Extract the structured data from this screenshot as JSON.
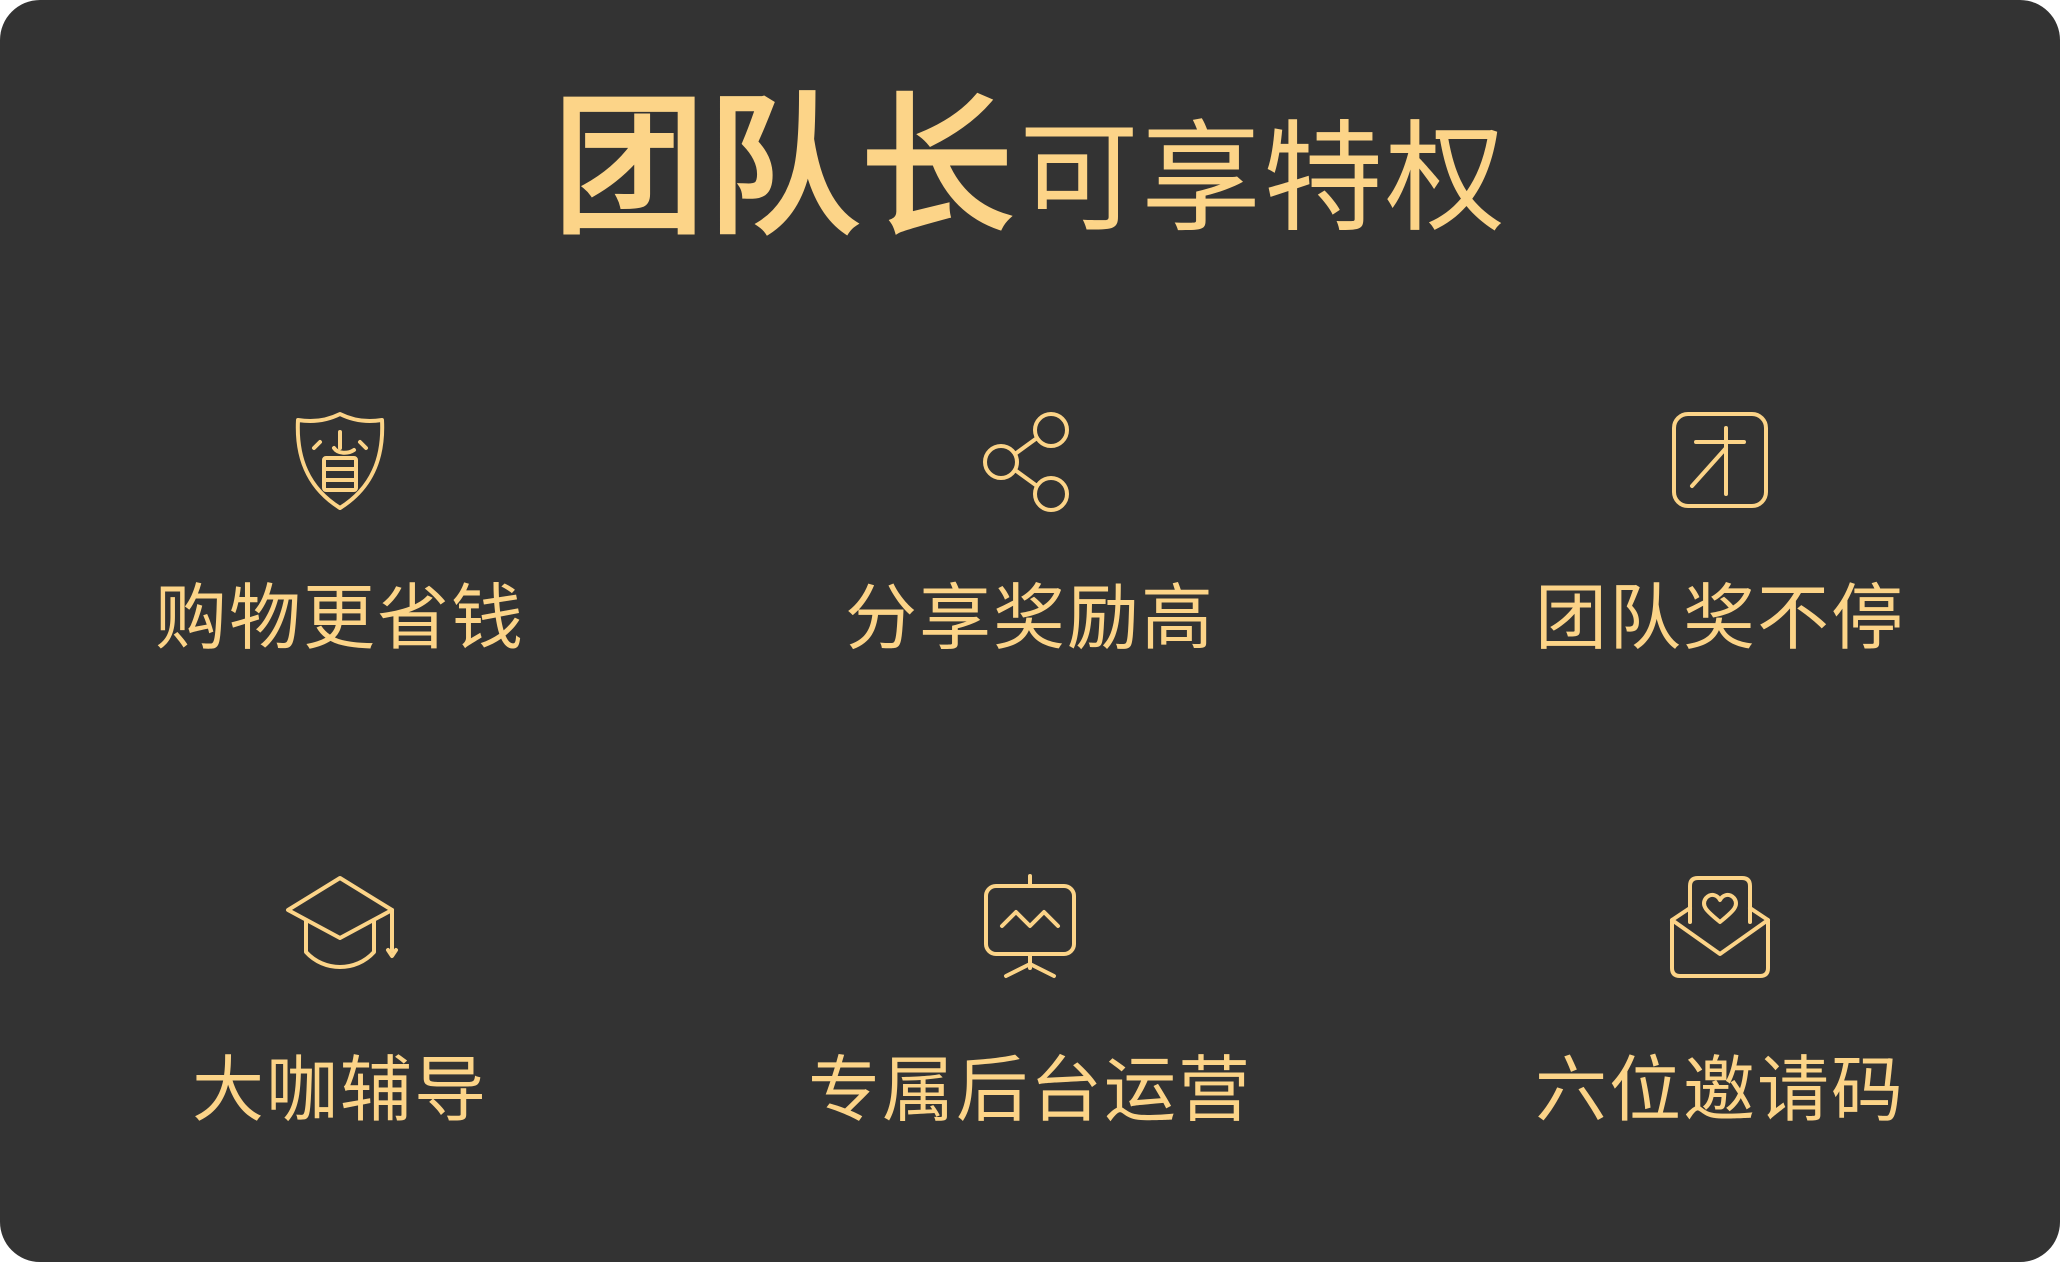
{
  "title": {
    "bold": "团队长",
    "light": "可享特权"
  },
  "privileges": [
    {
      "label": "购物更省钱",
      "icon": "shield-save-icon"
    },
    {
      "label": "分享奖励高",
      "icon": "share-icon"
    },
    {
      "label": "团队奖不停",
      "icon": "talent-box-icon"
    },
    {
      "label": "大咖辅导",
      "icon": "graduation-cap-icon"
    },
    {
      "label": "专属后台运营",
      "icon": "dashboard-screen-icon"
    },
    {
      "label": "六位邀请码",
      "icon": "invite-envelope-icon"
    }
  ],
  "colors": {
    "background": "#333333",
    "accent": "#fcd488"
  }
}
